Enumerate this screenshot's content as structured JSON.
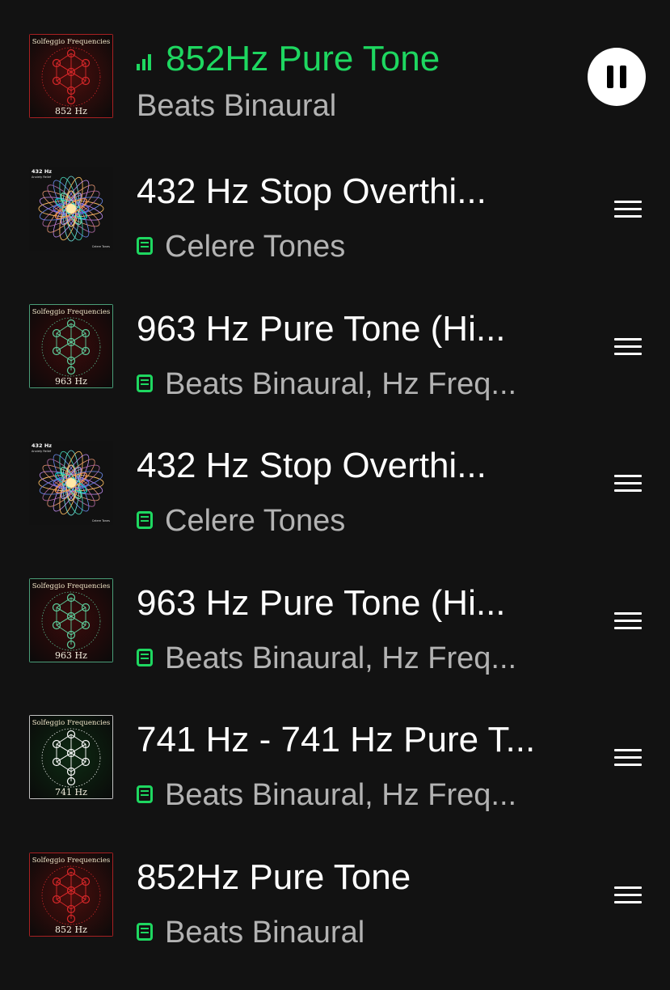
{
  "queue": {
    "tracks": [
      {
        "title": "852Hz Pure Tone",
        "artist": "Beats Binaural",
        "playing": true,
        "downloaded": false,
        "art": {
          "header": "Solfeggio Frequencies",
          "freq": "852 Hz",
          "accent": "#d9282a",
          "bg": "#4a0e0c"
        }
      },
      {
        "title": "432 Hz Stop Overthi...",
        "artist": "Celere Tones",
        "playing": false,
        "downloaded": true,
        "art": {
          "header": "432 Hz",
          "header2": "Anxiety Relief",
          "footer": "Celere Tones",
          "accent": "#9b59b6",
          "bg": "#111111"
        }
      },
      {
        "title": "963 Hz Pure Tone (Hi...",
        "artist": "Beats Binaural, Hz Freq...",
        "playing": false,
        "downloaded": true,
        "art": {
          "header": "Solfeggio Frequencies",
          "freq": "963 Hz",
          "accent": "#5ecf9d",
          "bg": "#3a0b0b"
        }
      },
      {
        "title": "432 Hz Stop Overthi...",
        "artist": "Celere Tones",
        "playing": false,
        "downloaded": true,
        "art": {
          "header": "432 Hz",
          "header2": "Anxiety Relief",
          "footer": "Celere Tones",
          "accent": "#9b59b6",
          "bg": "#111111"
        }
      },
      {
        "title": "963 Hz Pure Tone (Hi...",
        "artist": "Beats Binaural, Hz Freq...",
        "playing": false,
        "downloaded": true,
        "art": {
          "header": "Solfeggio Frequencies",
          "freq": "963 Hz",
          "accent": "#5ecf9d",
          "bg": "#3a0b0b"
        }
      },
      {
        "title": "741 Hz - 741 Hz Pure T...",
        "artist": "Beats Binaural, Hz Freq...",
        "playing": false,
        "downloaded": true,
        "art": {
          "header": "Solfeggio Frequencies",
          "freq": "741 Hz",
          "accent": "#ffffff",
          "bg": "#0d2a12"
        }
      },
      {
        "title": "852Hz Pure Tone",
        "artist": "Beats Binaural",
        "playing": false,
        "downloaded": true,
        "art": {
          "header": "Solfeggio Frequencies",
          "freq": "852 Hz",
          "accent": "#d9282a",
          "bg": "#4a0e0c"
        }
      }
    ]
  },
  "icons": {
    "playing": "equalizer-icon",
    "downloaded": "downloaded-icon",
    "pause": "pause-icon",
    "reorder": "drag-handle-icon"
  },
  "colors": {
    "background": "#121212",
    "accent": "#1ed760",
    "secondary_text": "#b3b3b3"
  }
}
